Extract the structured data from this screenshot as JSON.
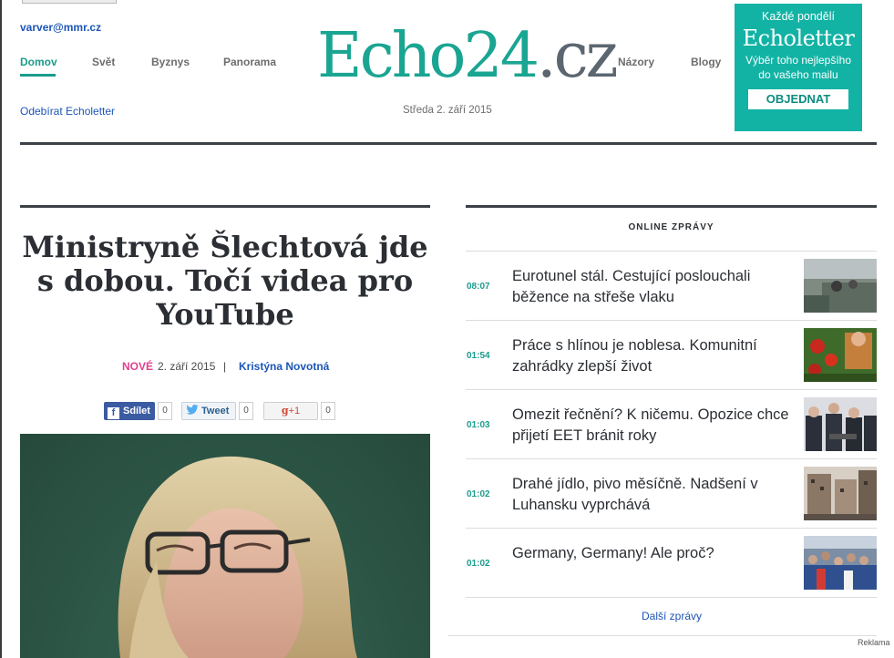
{
  "header": {
    "user_email": "varver@mmr.cz",
    "nav_left": [
      "Domov",
      "Svět",
      "Byznys",
      "Panorama"
    ],
    "nav_right": [
      "Názory",
      "Blogy"
    ],
    "active_nav": "Domov",
    "logo_main": "Echo24",
    "logo_tld": ".cz",
    "subscribe_link": "Odebírat Echoletter",
    "date": "Středa 2. září 2015"
  },
  "banner": {
    "top_line": "Každé pondělí",
    "title": "Echoletter",
    "subtitle_1": "Výběr toho nejlepšího",
    "subtitle_2": "do vašeho mailu",
    "button": "OBJEDNAT",
    "bg_color": "#12b3a4"
  },
  "article": {
    "title": "Ministryně Šlechtová jde s dobou. Točí videa pro YouTube",
    "badge": "NOVÉ",
    "date": "2. září 2015",
    "separator": "|",
    "author": "Kristýna Novotná",
    "share": {
      "facebook_label": "Sdílet",
      "facebook_count": "0",
      "twitter_label": "Tweet",
      "twitter_count": "0",
      "gplus_label": "+1",
      "gplus_prefix": "g",
      "gplus_count": "0"
    }
  },
  "online_news": {
    "heading": "ONLINE ZPRÁVY",
    "items": [
      {
        "time": "08:07",
        "text": "Eurotunel stál. Cestující poslouchali běžence na střeše vlaku"
      },
      {
        "time": "01:54",
        "text": "Práce s hlínou je noblesa. Komunitní zahrádky zlepší život"
      },
      {
        "time": "01:03",
        "text": "Omezit řečnění? K ničemu. Opozice chce přijetí EET bránit roky"
      },
      {
        "time": "01:02",
        "text": "Drahé jídlo, pivo měsíčně. Nadšení v Luhansku vyprchává"
      },
      {
        "time": "01:02",
        "text": "Germany, Germany! Ale proč?"
      }
    ],
    "more_link": "Další zprávy"
  },
  "footer": {
    "ad_label": "Reklama"
  },
  "colors": {
    "accent": "#1b9c8c",
    "link": "#1c55b8",
    "badge": "#e0408f"
  }
}
